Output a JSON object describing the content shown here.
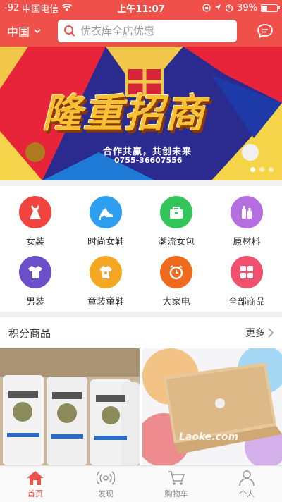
{
  "status_bar": {
    "signal": "-92",
    "carrier": "中国电信",
    "time": "上午11:07",
    "battery_percent": "39%",
    "battery_level": 0.39
  },
  "header": {
    "city": "中国",
    "search_placeholder": "优衣库全店优惠",
    "icons": [
      "chevron-down-icon",
      "search-icon",
      "message-icon"
    ]
  },
  "banner": {
    "title": "隆重招商",
    "slogan": "合作共赢，共创未来",
    "phone": "0755-36607556",
    "page_count": 3,
    "active_index": 0
  },
  "categories": [
    {
      "label": "女装",
      "icon": "dress-icon",
      "color": "#f2443f"
    },
    {
      "label": "时尚女鞋",
      "icon": "high-heel-icon",
      "color": "#2e9ff0"
    },
    {
      "label": "潮流女包",
      "icon": "handbag-icon",
      "color": "#33c45a"
    },
    {
      "label": "原材料",
      "icon": "bottles-icon",
      "color": "#b56ee0"
    },
    {
      "label": "男装",
      "icon": "shirt-icon",
      "color": "#6a4fc9"
    },
    {
      "label": "童装童鞋",
      "icon": "kids-clothes-icon",
      "color": "#f5a623"
    },
    {
      "label": "大家电",
      "icon": "clock-icon",
      "color": "#f06a1e"
    },
    {
      "label": "全部商品",
      "icon": "grid-icon",
      "color": "#f0506e"
    }
  ],
  "points_section": {
    "title": "积分商品",
    "more": "更多"
  },
  "products": [
    {
      "name": "rice-bags-image"
    },
    {
      "name": "laptop-image",
      "watermark": "Laoke.com"
    }
  ],
  "tabs": [
    {
      "label": "首页",
      "icon": "home-icon",
      "active": true
    },
    {
      "label": "发现",
      "icon": "broadcast-icon",
      "active": false
    },
    {
      "label": "购物车",
      "icon": "cart-icon",
      "active": false
    },
    {
      "label": "个人",
      "icon": "person-icon",
      "active": false
    }
  ],
  "colors": {
    "brand": "#f0504a",
    "tab_active": "#f0504a",
    "tab_inactive": "#888888"
  }
}
